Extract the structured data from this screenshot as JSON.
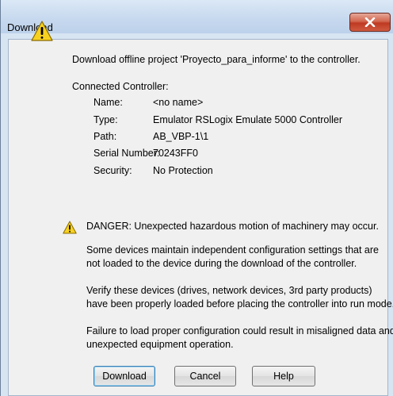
{
  "window": {
    "title": "Download",
    "close_glyph": "x"
  },
  "message": {
    "headline": "Download offline project 'Proyecto_para_informe' to the controller.",
    "connected_label": "Connected Controller:",
    "fields": [
      {
        "label": "Name:",
        "value": "<no name>"
      },
      {
        "label": "Type:",
        "value": "Emulator RSLogix Emulate 5000 Controller"
      },
      {
        "label": "Path:",
        "value": "AB_VBP-1\\1"
      },
      {
        "label": "Serial Number:",
        "value": "70243FF0"
      },
      {
        "label": "Security:",
        "value": "No Protection"
      }
    ],
    "danger": "DANGER: Unexpected hazardous motion of machinery may occur.",
    "para1_line1": "Some devices maintain independent configuration settings that are",
    "para1_line2": "not loaded to the device during the download of the controller.",
    "para2_line1": "Verify these devices (drives, network devices, 3rd party products)",
    "para2_line2": "have been properly loaded before placing the controller into run mode.",
    "para3_line1": "Failure to load proper configuration could result in misaligned data and",
    "para3_line2": "unexpected equipment operation."
  },
  "buttons": {
    "download": "Download",
    "cancel": "Cancel",
    "help": "Help"
  },
  "icons": {
    "warning_big": "warning-triangle-icon",
    "warning_small": "warning-triangle-icon",
    "close": "close-icon"
  },
  "colors": {
    "close_button": "#c8452c",
    "warning_fill": "#f7d11f",
    "frame": "#c6d8ee"
  }
}
